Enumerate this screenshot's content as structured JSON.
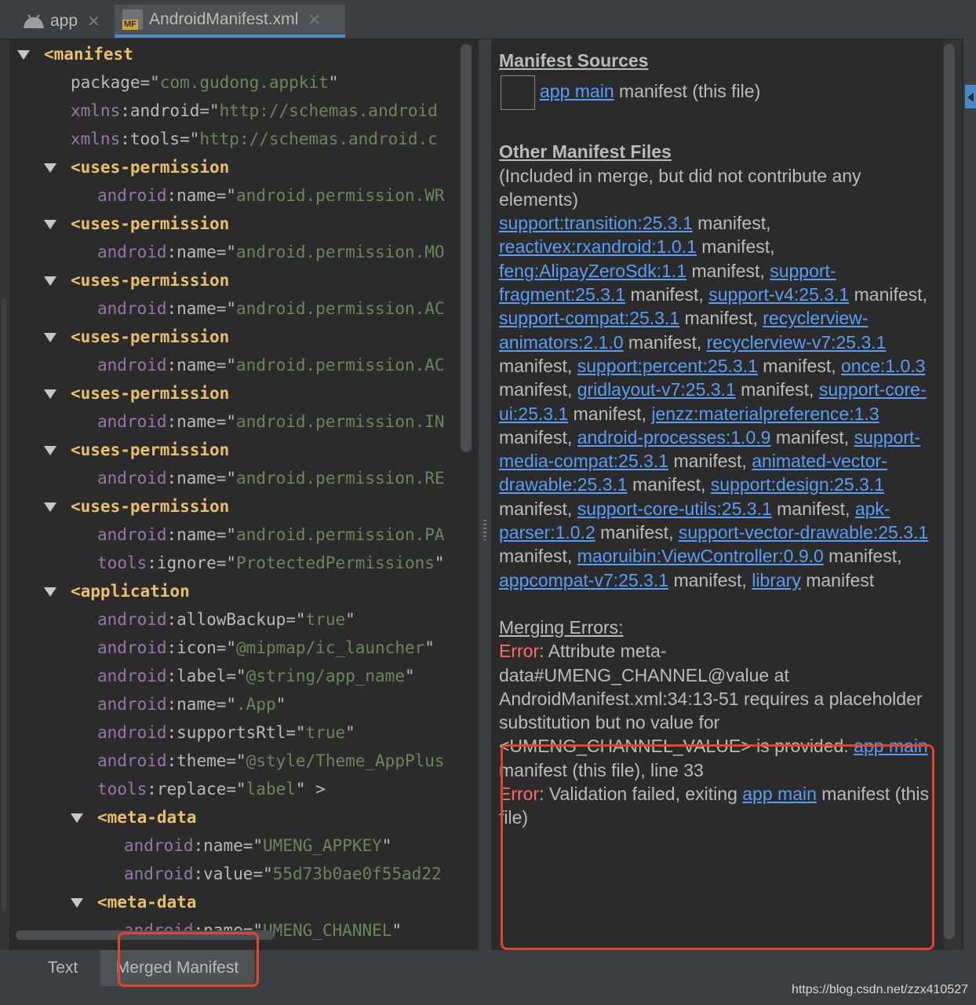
{
  "tabs": [
    {
      "label": "app",
      "icon": "android-icon"
    },
    {
      "label": "AndroidManifest.xml",
      "icon": "manifest-file-icon",
      "badge": "MF"
    }
  ],
  "code_lines": [
    {
      "indent": 0,
      "toggle": true,
      "parts": [
        {
          "t": "<manifest",
          "c": "tag"
        }
      ]
    },
    {
      "indent": 1,
      "parts": [
        {
          "t": "package",
          "c": "attr"
        },
        {
          "t": "=\"",
          "c": "plain"
        },
        {
          "t": "com.gudong.appkit",
          "c": "val"
        },
        {
          "t": "\"",
          "c": "plain"
        }
      ]
    },
    {
      "indent": 1,
      "parts": [
        {
          "t": "xmlns",
          "c": "ns"
        },
        {
          "t": ":android=\"",
          "c": "plain"
        },
        {
          "t": "http://schemas.android",
          "c": "val"
        }
      ]
    },
    {
      "indent": 1,
      "parts": [
        {
          "t": "xmlns",
          "c": "ns"
        },
        {
          "t": ":tools=\"",
          "c": "plain"
        },
        {
          "t": "http://schemas.android.c",
          "c": "val"
        }
      ]
    },
    {
      "indent": 1,
      "toggle": true,
      "parts": [
        {
          "t": "<uses-permission",
          "c": "tag"
        }
      ]
    },
    {
      "indent": 2,
      "parts": [
        {
          "t": "android",
          "c": "ns"
        },
        {
          "t": ":name=\"",
          "c": "plain"
        },
        {
          "t": "android.permission.WR",
          "c": "val"
        }
      ]
    },
    {
      "indent": 1,
      "toggle": true,
      "parts": [
        {
          "t": "<uses-permission",
          "c": "tag"
        }
      ]
    },
    {
      "indent": 2,
      "parts": [
        {
          "t": "android",
          "c": "ns"
        },
        {
          "t": ":name=\"",
          "c": "plain"
        },
        {
          "t": "android.permission.MO",
          "c": "val"
        }
      ]
    },
    {
      "indent": 1,
      "toggle": true,
      "parts": [
        {
          "t": "<uses-permission",
          "c": "tag"
        }
      ]
    },
    {
      "indent": 2,
      "parts": [
        {
          "t": "android",
          "c": "ns"
        },
        {
          "t": ":name=\"",
          "c": "plain"
        },
        {
          "t": "android.permission.AC",
          "c": "val"
        }
      ]
    },
    {
      "indent": 1,
      "toggle": true,
      "parts": [
        {
          "t": "<uses-permission",
          "c": "tag"
        }
      ]
    },
    {
      "indent": 2,
      "parts": [
        {
          "t": "android",
          "c": "ns"
        },
        {
          "t": ":name=\"",
          "c": "plain"
        },
        {
          "t": "android.permission.AC",
          "c": "val"
        }
      ]
    },
    {
      "indent": 1,
      "toggle": true,
      "parts": [
        {
          "t": "<uses-permission",
          "c": "tag"
        }
      ]
    },
    {
      "indent": 2,
      "parts": [
        {
          "t": "android",
          "c": "ns"
        },
        {
          "t": ":name=\"",
          "c": "plain"
        },
        {
          "t": "android.permission.IN",
          "c": "val"
        }
      ]
    },
    {
      "indent": 1,
      "toggle": true,
      "parts": [
        {
          "t": "<uses-permission",
          "c": "tag"
        }
      ]
    },
    {
      "indent": 2,
      "parts": [
        {
          "t": "android",
          "c": "ns"
        },
        {
          "t": ":name=\"",
          "c": "plain"
        },
        {
          "t": "android.permission.RE",
          "c": "val"
        }
      ]
    },
    {
      "indent": 1,
      "toggle": true,
      "parts": [
        {
          "t": "<uses-permission",
          "c": "tag"
        }
      ]
    },
    {
      "indent": 2,
      "parts": [
        {
          "t": "android",
          "c": "ns"
        },
        {
          "t": ":name=\"",
          "c": "plain"
        },
        {
          "t": "android.permission.PA",
          "c": "val"
        }
      ]
    },
    {
      "indent": 2,
      "parts": [
        {
          "t": "tools",
          "c": "ns"
        },
        {
          "t": ":ignore=\"",
          "c": "plain"
        },
        {
          "t": "ProtectedPermissions",
          "c": "val"
        },
        {
          "t": "\"",
          "c": "plain"
        }
      ]
    },
    {
      "indent": 1,
      "toggle": true,
      "parts": [
        {
          "t": "<application",
          "c": "tag"
        }
      ]
    },
    {
      "indent": 2,
      "parts": [
        {
          "t": "android",
          "c": "ns"
        },
        {
          "t": ":allowBackup=\"",
          "c": "plain"
        },
        {
          "t": "true",
          "c": "val"
        },
        {
          "t": "\"",
          "c": "plain"
        }
      ]
    },
    {
      "indent": 2,
      "parts": [
        {
          "t": "android",
          "c": "ns"
        },
        {
          "t": ":icon=\"",
          "c": "plain"
        },
        {
          "t": "@mipmap/ic_launcher",
          "c": "val"
        },
        {
          "t": "\"",
          "c": "plain"
        }
      ]
    },
    {
      "indent": 2,
      "parts": [
        {
          "t": "android",
          "c": "ns"
        },
        {
          "t": ":label=\"",
          "c": "plain"
        },
        {
          "t": "@string/app_name",
          "c": "val"
        },
        {
          "t": "\"",
          "c": "plain"
        }
      ]
    },
    {
      "indent": 2,
      "parts": [
        {
          "t": "android",
          "c": "ns"
        },
        {
          "t": ":name=\"",
          "c": "plain"
        },
        {
          "t": ".App",
          "c": "val"
        },
        {
          "t": "\"",
          "c": "plain"
        }
      ]
    },
    {
      "indent": 2,
      "parts": [
        {
          "t": "android",
          "c": "ns"
        },
        {
          "t": ":supportsRtl=\"",
          "c": "plain"
        },
        {
          "t": "true",
          "c": "val"
        },
        {
          "t": "\"",
          "c": "plain"
        }
      ]
    },
    {
      "indent": 2,
      "parts": [
        {
          "t": "android",
          "c": "ns"
        },
        {
          "t": ":theme=\"",
          "c": "plain"
        },
        {
          "t": "@style/Theme_AppPlus",
          "c": "val"
        }
      ]
    },
    {
      "indent": 2,
      "parts": [
        {
          "t": "tools",
          "c": "ns"
        },
        {
          "t": ":replace=\"",
          "c": "plain"
        },
        {
          "t": "label",
          "c": "val"
        },
        {
          "t": "\" >",
          "c": "plain"
        }
      ]
    },
    {
      "indent": 2,
      "toggle": true,
      "parts": [
        {
          "t": "<meta-data",
          "c": "tag"
        }
      ]
    },
    {
      "indent": 3,
      "parts": [
        {
          "t": "android",
          "c": "ns"
        },
        {
          "t": ":name=\"",
          "c": "plain"
        },
        {
          "t": "UMENG_APPKEY",
          "c": "val"
        },
        {
          "t": "\"",
          "c": "plain"
        }
      ]
    },
    {
      "indent": 3,
      "parts": [
        {
          "t": "android",
          "c": "ns"
        },
        {
          "t": ":value=\"",
          "c": "plain"
        },
        {
          "t": "55d73b0ae0f55ad22",
          "c": "val"
        }
      ]
    },
    {
      "indent": 2,
      "toggle": true,
      "parts": [
        {
          "t": "<meta-data",
          "c": "tag"
        }
      ]
    },
    {
      "indent": 3,
      "parts": [
        {
          "t": "android",
          "c": "ns"
        },
        {
          "t": ":name=\"",
          "c": "plain"
        },
        {
          "t": "UMENG_CHANNEL",
          "c": "val"
        },
        {
          "t": "\"",
          "c": "plain"
        }
      ]
    }
  ],
  "sources": {
    "heading": "Manifest Sources",
    "app_link": "app main",
    "app_suffix": " manifest (this file)"
  },
  "other_files": {
    "heading": "Other Manifest Files",
    "note": "(Included in merge, but did not contribute any elements)",
    "items": [
      {
        "name": "support:transition:25.3.1",
        "suffix": " manifest, "
      },
      {
        "name": "reactivex:rxandroid:1.0.1",
        "suffix": " manifest, "
      },
      {
        "name": "feng:AlipayZeroSdk:1.1",
        "suffix": " manifest, "
      },
      {
        "name": "support-fragment:25.3.1",
        "suffix": " manifest, "
      },
      {
        "name": "support-v4:25.3.1",
        "suffix": " manifest, "
      },
      {
        "name": "support-compat:25.3.1",
        "suffix": " manifest, "
      },
      {
        "name": "recyclerview-animators:2.1.0",
        "suffix": " manifest, "
      },
      {
        "name": "recyclerview-v7:25.3.1",
        "suffix": " manifest, "
      },
      {
        "name": "support:percent:25.3.1",
        "suffix": " manifest, "
      },
      {
        "name": "once:1.0.3",
        "suffix": " manifest, "
      },
      {
        "name": "gridlayout-v7:25.3.1",
        "suffix": " manifest, "
      },
      {
        "name": "support-core-ui:25.3.1",
        "suffix": " manifest, "
      },
      {
        "name": "jenzz:materialpreference:1.3",
        "suffix": " manifest, "
      },
      {
        "name": "android-processes:1.0.9",
        "suffix": " manifest, "
      },
      {
        "name": "support-media-compat:25.3.1",
        "suffix": " manifest, "
      },
      {
        "name": "animated-vector-drawable:25.3.1",
        "suffix": " manifest, "
      },
      {
        "name": "support:design:25.3.1",
        "suffix": " manifest, "
      },
      {
        "name": "support-core-utils:25.3.1",
        "suffix": " manifest, "
      },
      {
        "name": "apk-parser:1.0.2",
        "suffix": " manifest, "
      },
      {
        "name": "support-vector-drawable:25.3.1",
        "suffix": " manifest, "
      },
      {
        "name": "maoruibin:ViewController:0.9.0",
        "suffix": " manifest, "
      },
      {
        "name": "appcompat-v7:25.3.1",
        "suffix": " manifest, "
      },
      {
        "name": "library",
        "suffix": " manifest"
      }
    ]
  },
  "errors": {
    "heading": "Merging Errors:",
    "error1": {
      "label": "Error",
      "text": ": Attribute meta-data#UMENG_CHANNEL@value at AndroidManifest.xml:34:13-51 requires a placeholder substitution but no value for <UMENG_CHANNEL_VALUE> is provided. ",
      "link": "app main",
      "tail": " manifest (this file), line 33"
    },
    "error2": {
      "label": "Error",
      "text": ": Validation failed, exiting ",
      "link": "app main",
      "tail": " manifest (this file)"
    }
  },
  "bottom_tabs": {
    "text": "Text",
    "merged": "Merged Manifest"
  },
  "watermark": "https://blog.csdn.net/zzx410527",
  "colors": {
    "background": "#2b2b2b",
    "tag": "#e8bf6a",
    "namespace": "#9876aa",
    "value": "#6a8759",
    "link": "#589df6",
    "error": "#ff6b68",
    "highlight_box": "#e2452b"
  }
}
